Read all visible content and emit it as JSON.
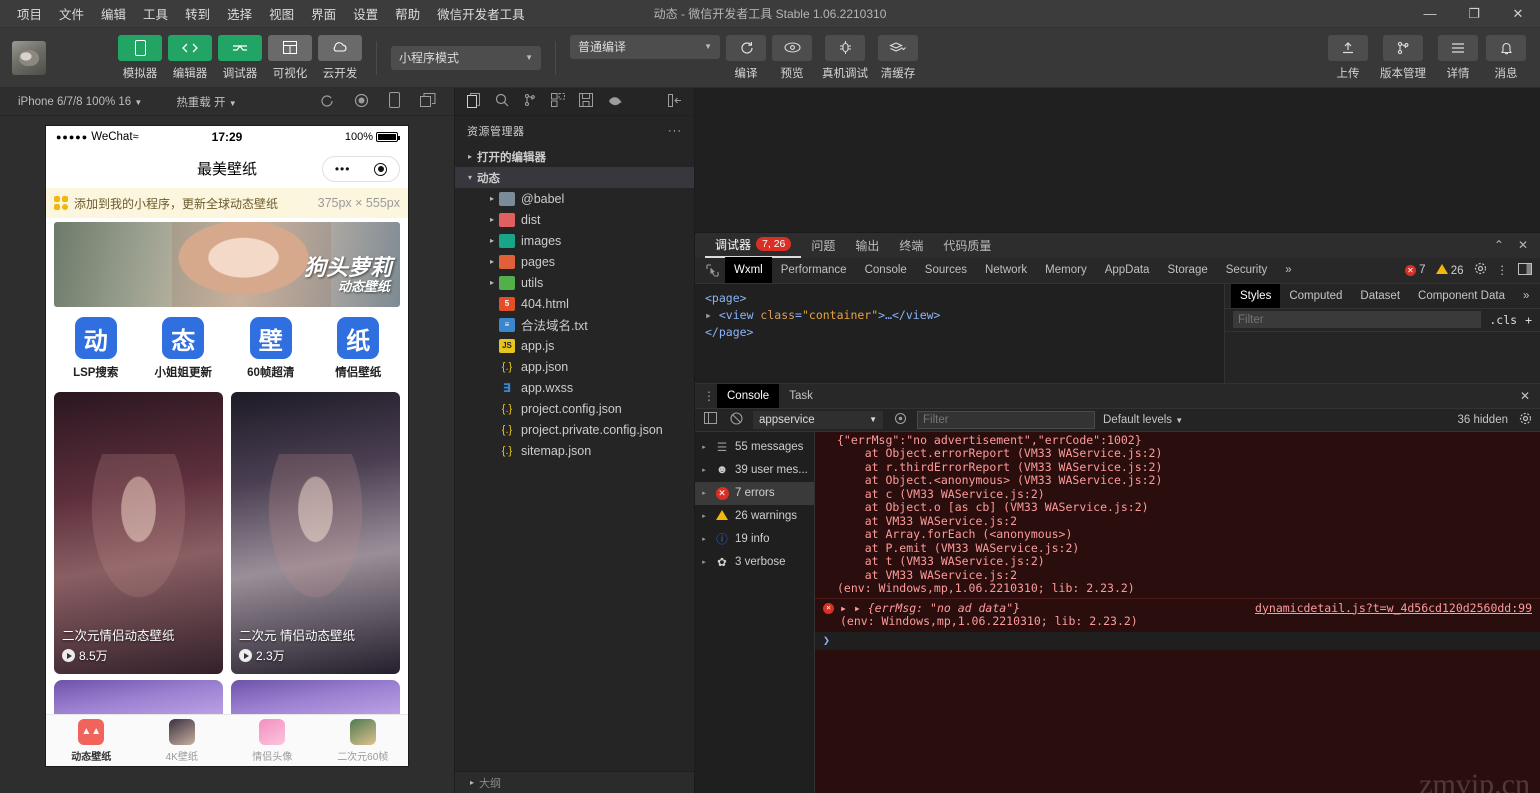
{
  "titlebar": {
    "menu": [
      "项目",
      "文件",
      "编辑",
      "工具",
      "转到",
      "选择",
      "视图",
      "界面",
      "设置",
      "帮助",
      "微信开发者工具"
    ],
    "title": "动态 - 微信开发者工具 Stable 1.06.2210310",
    "minimize": "—",
    "maximize": "❐",
    "close": "✕"
  },
  "toolbar": {
    "modes": [
      {
        "label": "模拟器",
        "icon": "phone-icon",
        "active": true
      },
      {
        "label": "编辑器",
        "icon": "code-icon",
        "active": true
      },
      {
        "label": "调试器",
        "icon": "debug-icon",
        "active": true
      },
      {
        "label": "可视化",
        "icon": "layout-icon",
        "active": false
      },
      {
        "label": "云开发",
        "icon": "cloud-icon",
        "active": false
      }
    ],
    "mode_select": "小程序模式",
    "compile_select": "普通编译",
    "actions": [
      {
        "label": "编译",
        "icon": "refresh-icon"
      },
      {
        "label": "预览",
        "icon": "eye-icon"
      },
      {
        "label": "真机调试",
        "icon": "bug-icon"
      },
      {
        "label": "清缓存",
        "icon": "layers-icon"
      }
    ],
    "right_actions": [
      {
        "label": "上传",
        "icon": "upload-icon"
      },
      {
        "label": "版本管理",
        "icon": "branch-icon"
      },
      {
        "label": "详情",
        "icon": "menu-icon"
      },
      {
        "label": "消息",
        "icon": "bell-icon"
      }
    ]
  },
  "simulator": {
    "device": "iPhone 6/7/8 100% 16",
    "hot_reload": "热重载 开",
    "status": {
      "dots": "●●●●●",
      "carrier": "WeChat",
      "wifi": "≈",
      "time": "17:29",
      "battery": "100%"
    },
    "nav_title": "最美壁纸",
    "banner_text": "添加到我的小程序，更新全球动态壁纸",
    "size_tag": "375px × 555px",
    "hero": {
      "title": "狗头萝莉",
      "subtitle": "动态壁纸"
    },
    "quick_actions": [
      {
        "glyph": "动",
        "label": "LSP搜索"
      },
      {
        "glyph": "态",
        "label": "小姐姐更新"
      },
      {
        "glyph": "壁",
        "label": "60帧超清"
      },
      {
        "glyph": "纸",
        "label": "情侣壁纸"
      }
    ],
    "cards": [
      {
        "title": "二次元情侣动态壁纸",
        "plays": "8.5万"
      },
      {
        "title": "二次元 情侣动态壁纸",
        "plays": "2.3万"
      }
    ],
    "tabbar": [
      {
        "label": "动态壁纸",
        "active": true
      },
      {
        "label": "4K壁纸",
        "active": false
      },
      {
        "label": "情侣头像",
        "active": false
      },
      {
        "label": "二次元60帧",
        "active": false
      }
    ]
  },
  "explorer": {
    "icons": [
      "files-icon",
      "search-icon",
      "source-control-icon",
      "extensions-icon",
      "save-icon",
      "debug-icon",
      "collapse-icon"
    ],
    "title": "资源管理器",
    "more": "···",
    "sections": [
      {
        "label": "打开的编辑器",
        "expanded": false
      },
      {
        "label": "动态",
        "expanded": true
      }
    ],
    "tree": [
      {
        "label": "@babel",
        "type": "folder",
        "color": "f-blue",
        "level": 2,
        "arrow": "▸"
      },
      {
        "label": "dist",
        "type": "folder",
        "color": "f-red",
        "level": 2,
        "arrow": "▸"
      },
      {
        "label": "images",
        "type": "folder",
        "color": "f-teal",
        "level": 2,
        "arrow": "▸"
      },
      {
        "label": "pages",
        "type": "folder",
        "color": "f-org",
        "level": 2,
        "arrow": "▸"
      },
      {
        "label": "utils",
        "type": "folder",
        "color": "f-grn",
        "level": 2,
        "arrow": "▸"
      },
      {
        "label": "404.html",
        "type": "html",
        "glyph": "5",
        "level": 2,
        "arrow": ""
      },
      {
        "label": "合法域名.txt",
        "type": "txt",
        "glyph": "≡",
        "level": 2,
        "arrow": ""
      },
      {
        "label": "app.js",
        "type": "js",
        "glyph": "JS",
        "level": 2,
        "arrow": ""
      },
      {
        "label": "app.json",
        "type": "json",
        "glyph": "{.}",
        "level": 2,
        "arrow": ""
      },
      {
        "label": "app.wxss",
        "type": "wxss",
        "glyph": "∃",
        "level": 2,
        "arrow": ""
      },
      {
        "label": "project.config.json",
        "type": "json",
        "glyph": "{.}",
        "level": 2,
        "arrow": ""
      },
      {
        "label": "project.private.config.json",
        "type": "json",
        "glyph": "{.}",
        "level": 2,
        "arrow": ""
      },
      {
        "label": "sitemap.json",
        "type": "json",
        "glyph": "{.}",
        "level": 2,
        "arrow": ""
      }
    ],
    "bottom_section": "大纲"
  },
  "debugger": {
    "panel_tabs": [
      {
        "label": "调试器",
        "badge": "7, 26",
        "active": true
      },
      {
        "label": "问题",
        "badge": "",
        "active": false
      },
      {
        "label": "输出",
        "badge": "",
        "active": false
      },
      {
        "label": "终端",
        "badge": "",
        "active": false
      },
      {
        "label": "代码质量",
        "badge": "",
        "active": false
      }
    ],
    "panel_collapse": "⌃",
    "panel_close": "✕",
    "devtools_tabs": [
      "Wxml",
      "Performance",
      "Console",
      "Sources",
      "Network",
      "Memory",
      "AppData",
      "Storage",
      "Security"
    ],
    "devtools_active": "Wxml",
    "devtools_overflow": "»",
    "error_count": "7",
    "warning_count": "26",
    "wxml": {
      "line1": "<page>",
      "line2_tag": "<view ",
      "line2_attr": "class",
      "line2_val": "\"container\"",
      "line2_rest": ">…</view>",
      "line3": "</page>",
      "arrow": "▸"
    },
    "styles": {
      "tabs": [
        "Styles",
        "Computed",
        "Dataset",
        "Component Data"
      ],
      "active": "Styles",
      "overflow": "»",
      "filter_placeholder": "Filter",
      "cls": ".cls",
      "plus": "+"
    },
    "console": {
      "tabs": [
        "Console",
        "Task"
      ],
      "active": "Console",
      "close": "✕",
      "kebab": "⋮",
      "context": "appservice",
      "filter_placeholder": "Filter",
      "levels": "Default levels",
      "hidden": "36 hidden",
      "sidebar": [
        {
          "label": "55 messages",
          "icon": "list-icon",
          "active": false
        },
        {
          "label": "39 user mes...",
          "icon": "user-icon",
          "active": false
        },
        {
          "label": "7 errors",
          "icon": "error-icon",
          "active": true
        },
        {
          "label": "26 warnings",
          "icon": "warning-icon",
          "active": false
        },
        {
          "label": "19 info",
          "icon": "info-icon",
          "active": false
        },
        {
          "label": "3 verbose",
          "icon": "verbose-icon",
          "active": false
        }
      ],
      "error_block": {
        "head": "{\"errMsg\":\"no advertisement\",\"errCode\":1002}",
        "stack": [
          "    at Object.errorReport (VM33 WAService.js:2)",
          "    at r.thirdErrorReport (VM33 WAService.js:2)",
          "    at Object.<anonymous> (VM33 WAService.js:2)",
          "    at c (VM33 WAService.js:2)",
          "    at Object.o [as cb] (VM33 WAService.js:2)",
          "    at VM33 WAService.js:2",
          "    at Array.forEach (<anonymous>)",
          "    at P.emit (VM33 WAService.js:2)",
          "    at t (VM33 WAService.js:2)",
          "    at VM33 WAService.js:2"
        ],
        "env": "(env: Windows,mp,1.06.2210310; lib: 2.23.2)"
      },
      "error_row2": {
        "arrows": "▸ ▸",
        "message": "{errMsg: \"no ad data\"}",
        "env": "(env: Windows,mp,1.06.2210310; lib: 2.23.2)",
        "source": "dynamicdetail.js?t=w_4d56cd120d2560dd:99"
      },
      "prompt": "❯"
    }
  },
  "watermark": "zmvip.cn"
}
